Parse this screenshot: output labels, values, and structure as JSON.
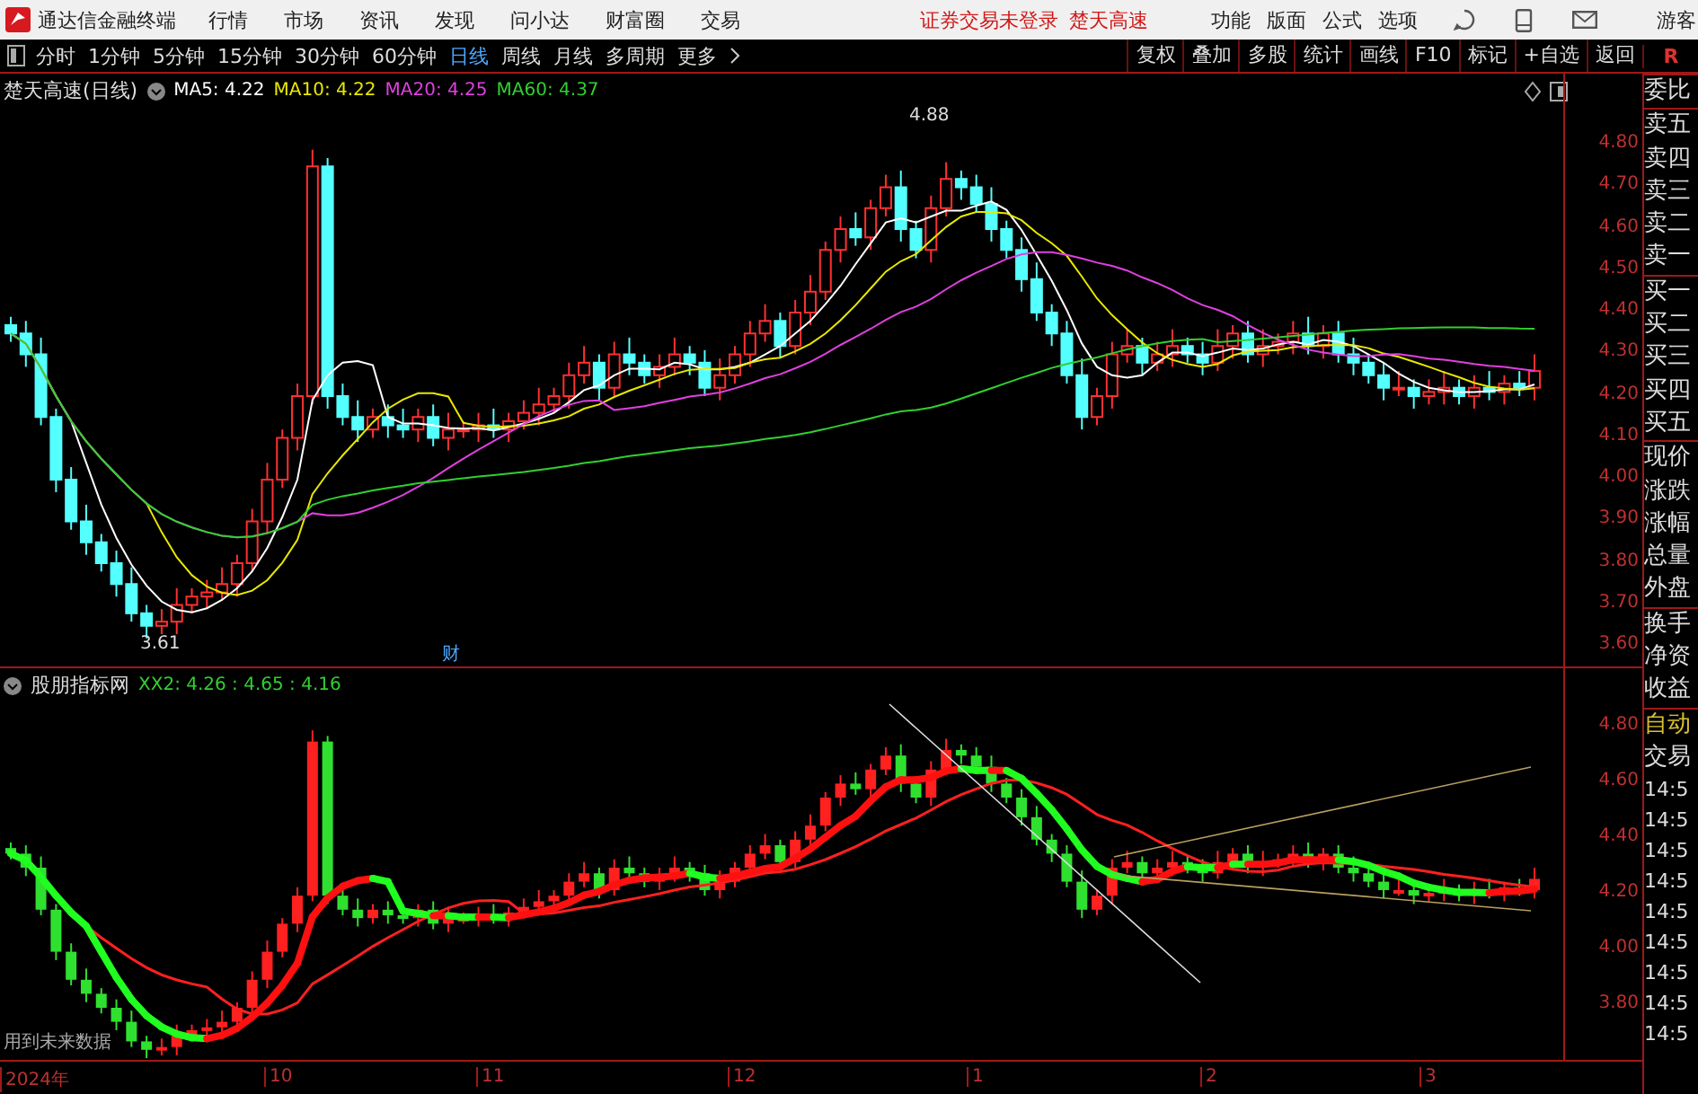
{
  "menu_bar": {
    "app_name": "通达信金融终端",
    "items": [
      "行情",
      "市场",
      "资讯",
      "发现",
      "问小达",
      "财富圈",
      "交易"
    ],
    "notices": [
      "证券交易未登录",
      "楚天高速"
    ],
    "right_items": [
      "功能",
      "版面",
      "公式",
      "选项"
    ],
    "user": "游客"
  },
  "toolbar": {
    "periods": [
      {
        "label": "分时",
        "selected": false
      },
      {
        "label": "1分钟",
        "selected": false
      },
      {
        "label": "5分钟",
        "selected": false
      },
      {
        "label": "15分钟",
        "selected": false
      },
      {
        "label": "30分钟",
        "selected": false
      },
      {
        "label": "60分钟",
        "selected": false
      },
      {
        "label": "日线",
        "selected": true
      },
      {
        "label": "周线",
        "selected": false
      },
      {
        "label": "月线",
        "selected": false
      },
      {
        "label": "多周期",
        "selected": false
      },
      {
        "label": "更多",
        "selected": false
      }
    ],
    "tools": [
      "复权",
      "叠加",
      "多股",
      "统计",
      "画线",
      "F10",
      "标记",
      "+自选",
      "返回"
    ],
    "corner": "R"
  },
  "main_chart": {
    "title": "楚天高速(日线)",
    "ma_legend": [
      {
        "label": "MA5: 4.22",
        "color": "#ffffff"
      },
      {
        "label": "MA10: 4.22",
        "color": "#e8e800"
      },
      {
        "label": "MA20: 4.25",
        "color": "#e040e0"
      },
      {
        "label": "MA60: 4.37",
        "color": "#30d030"
      }
    ],
    "high_label": "4.88",
    "low_label": "3.61",
    "event_marker": "财",
    "yticks": [
      "4.80",
      "4.70",
      "4.60",
      "4.50",
      "4.40",
      "4.30",
      "4.20",
      "4.10",
      "4.00",
      "3.90",
      "3.80",
      "3.70",
      "3.60"
    ]
  },
  "indicator_chart": {
    "name": "股朋指标网",
    "values": "XX2: 4.26 : 4.65 : 4.16",
    "note": "用到未来数据",
    "yticks": [
      "4.80",
      "4.60",
      "4.40",
      "4.20",
      "4.00",
      "3.80"
    ]
  },
  "date_axis": [
    "2024年",
    "10",
    "11",
    "12",
    "1",
    "2",
    "3"
  ],
  "quote_panel": {
    "groups": [
      [
        "委比"
      ],
      [
        "卖五",
        "卖四",
        "卖三",
        "卖二",
        "卖一"
      ],
      [
        "买一",
        "买二",
        "买三",
        "买四",
        "买五"
      ],
      [
        "现价",
        "涨跌",
        "涨幅",
        "总量",
        "外盘"
      ],
      [
        "换手",
        "净资",
        "收益"
      ]
    ],
    "mode": "自动",
    "trade_title": "交易",
    "trade_times": [
      "14:5",
      "14:5",
      "14:5",
      "14:5",
      "14:5",
      "14:5",
      "14:5",
      "14:5",
      "14:5"
    ]
  }
}
